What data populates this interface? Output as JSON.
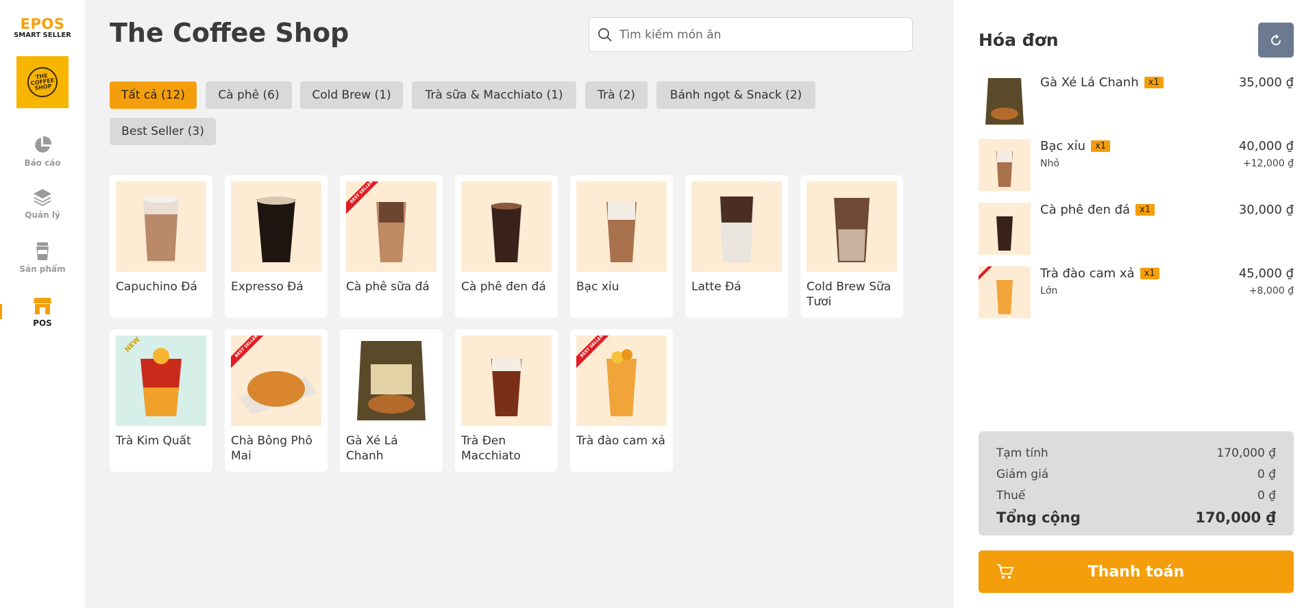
{
  "brand": {
    "name": "EPOS",
    "sub": "SMART SELLER",
    "logo_text": "THE COFFEE SHOP"
  },
  "nav": [
    {
      "label": "Báo cáo",
      "icon": "pie-chart-icon",
      "active": false
    },
    {
      "label": "Quản lý",
      "icon": "layers-icon",
      "active": false
    },
    {
      "label": "Sản phẩm",
      "icon": "cup-icon",
      "active": false
    },
    {
      "label": "POS",
      "icon": "store-icon",
      "active": true
    }
  ],
  "header": {
    "title": "The Coffee Shop",
    "search_placeholder": "Tìm kiếm món ăn"
  },
  "categories": [
    {
      "label": "Tất cả (12)",
      "active": true
    },
    {
      "label": "Cà phê (6)",
      "active": false
    },
    {
      "label": "Cold Brew (1)",
      "active": false
    },
    {
      "label": "Trà sữa & Macchiato (1)",
      "active": false
    },
    {
      "label": "Trà (2)",
      "active": false
    },
    {
      "label": "Bánh ngọt & Snack (2)",
      "active": false
    },
    {
      "label": "Best Seller (3)",
      "active": false
    }
  ],
  "products": [
    {
      "name": "Capuchino Đá",
      "badge": ""
    },
    {
      "name": "Expresso Đá",
      "badge": ""
    },
    {
      "name": "Cà phê sữa đá",
      "badge": "BEST SELLER"
    },
    {
      "name": "Cà phê đen đá",
      "badge": ""
    },
    {
      "name": "Bạc xỉu",
      "badge": ""
    },
    {
      "name": "Latte Đá",
      "badge": ""
    },
    {
      "name": "Cold Brew Sữa Tươi",
      "badge": ""
    },
    {
      "name": "Trà Kim Quất",
      "badge": "NEW"
    },
    {
      "name": "Chà Bông Phô Mai",
      "badge": "BEST SELLER"
    },
    {
      "name": "Gà Xé Lá Chanh",
      "badge": ""
    },
    {
      "name": "Trà Đen Macchiato",
      "badge": ""
    },
    {
      "name": "Trà đào cam xả",
      "badge": "BEST SELLER"
    }
  ],
  "order": {
    "title": "Hóa đơn",
    "items": [
      {
        "name": "Gà Xé Lá Chanh",
        "qty": "x1",
        "option": "",
        "price": "35,000 ₫",
        "extra": ""
      },
      {
        "name": "Bạc xỉu",
        "qty": "x1",
        "option": "Nhỏ",
        "price": "40,000 ₫",
        "extra": "+12,000 ₫"
      },
      {
        "name": "Cà phê đen đá",
        "qty": "x1",
        "option": "",
        "price": "30,000 ₫",
        "extra": ""
      },
      {
        "name": "Trà đào cam xả",
        "qty": "x1",
        "option": "Lớn",
        "price": "45,000 ₫",
        "extra": "+8,000 ₫"
      }
    ],
    "summary": {
      "subtotal_label": "Tạm tính",
      "subtotal": "170,000 ₫",
      "discount_label": "Giảm giá",
      "discount": "0 ₫",
      "tax_label": "Thuế",
      "tax": "0 ₫",
      "total_label": "Tổng cộng",
      "total": "170,000 ₫"
    },
    "pay_label": "Thanh toán"
  },
  "colors": {
    "accent": "#f59e0b",
    "refresh": "#6b7a90",
    "thumb_bg": "#fdecd3"
  }
}
